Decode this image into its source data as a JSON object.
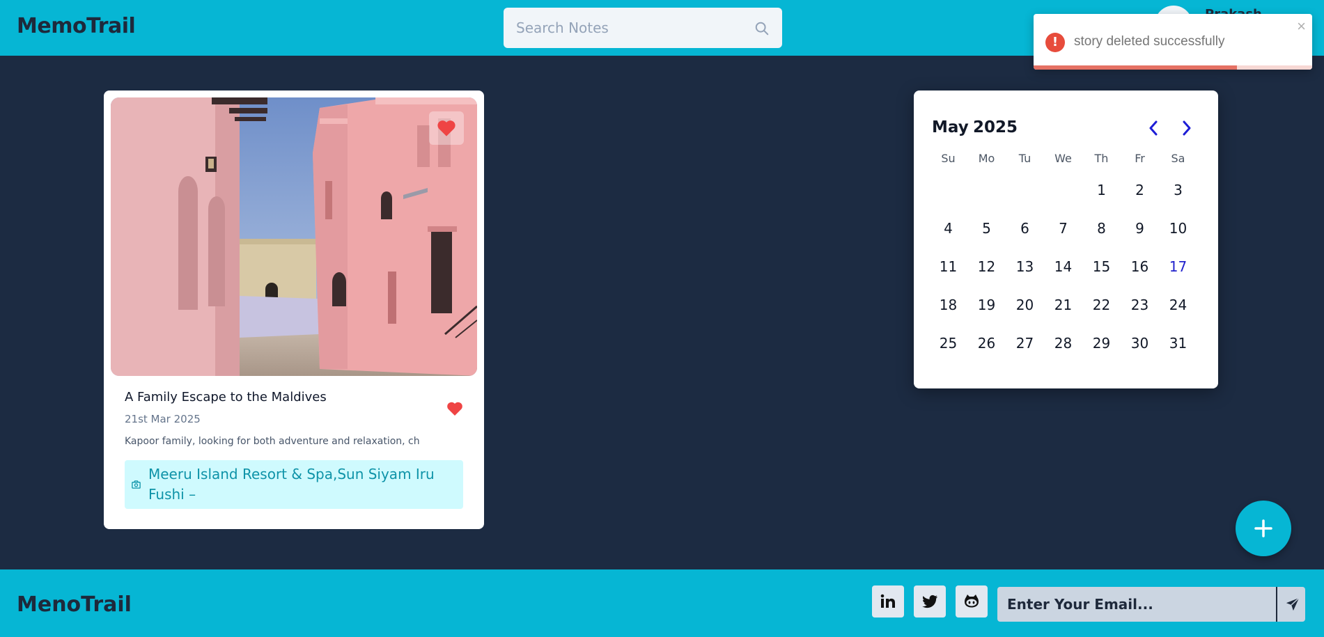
{
  "header": {
    "logo": "MemoTrail",
    "search_placeholder": "Search Notes",
    "username": "Prakash..."
  },
  "toast": {
    "message": "story deleted successfully",
    "close_symbol": "×",
    "icon_symbol": "!",
    "progress": 0.73,
    "type": "error"
  },
  "story": {
    "title": "A Family Escape to the Maldives",
    "date": "21st Mar 2025",
    "excerpt": "Kapoor family, looking for both adventure and relaxation, ch",
    "location": "Meeru Island Resort & Spa,Sun Siyam Iru Fushi –",
    "favorite": true
  },
  "calendar": {
    "month": "May",
    "year": "2025",
    "weekdays": [
      "Su",
      "Mo",
      "Tu",
      "We",
      "Th",
      "Fr",
      "Sa"
    ],
    "first_weekday_index": 4,
    "days_in_month": 31,
    "today": 17
  },
  "fab": {
    "icon": "plus-icon"
  },
  "footer": {
    "logo": "MenoTrail",
    "email_placeholder": "Enter Your Email...",
    "social": [
      "linkedin-icon",
      "twitter-icon",
      "github-icon"
    ]
  },
  "colors": {
    "primary": "#06b6d4",
    "background": "#1c2b42",
    "heart": "#ef4444",
    "toast_error": "#e74c3c",
    "calendar_today": "#2222cc",
    "calendar_nav": "#1d1dd6"
  }
}
